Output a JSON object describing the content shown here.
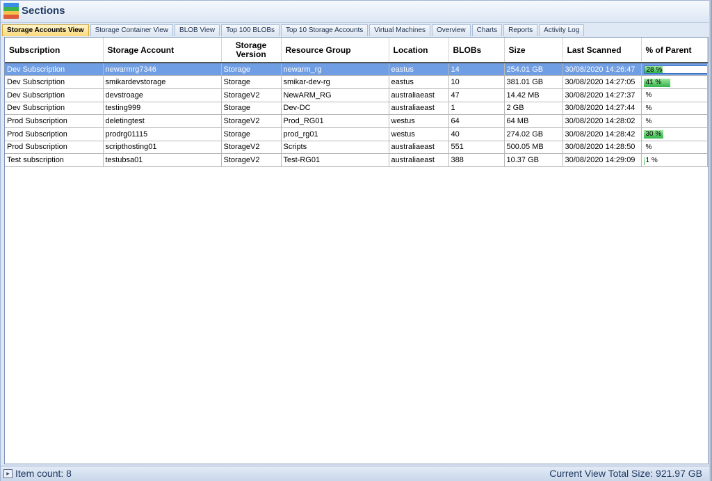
{
  "app": {
    "title": "Sections",
    "icon": "sections-stack-icon",
    "icon_colors": [
      "#3a8ee6",
      "#3cb34b",
      "#f2c14e",
      "#e05a3a"
    ]
  },
  "tabs": [
    {
      "label": "Storage Accounts View",
      "active": true
    },
    {
      "label": "Storage Container View",
      "active": false
    },
    {
      "label": "BLOB View",
      "active": false
    },
    {
      "label": "Top 100 BLOBs",
      "active": false
    },
    {
      "label": "Top 10 Storage Accounts",
      "active": false
    },
    {
      "label": "Virtual Machines",
      "active": false
    },
    {
      "label": "Overview",
      "active": false
    },
    {
      "label": "Charts",
      "active": false
    },
    {
      "label": "Reports",
      "active": false
    },
    {
      "label": "Activity Log",
      "active": false
    }
  ],
  "table": {
    "columns": [
      "Subscription",
      "Storage Account",
      "Storage Version",
      "Resource Group",
      "Location",
      "BLOBs",
      "Size",
      "Last Scanned",
      "% of Parent"
    ],
    "rows": [
      {
        "subscription": "Dev Subscription",
        "account": "newarmrg7346",
        "version": "Storage",
        "group": "newarm_rg",
        "location": "eastus",
        "blobs": "14",
        "size": "254.01 GB",
        "scanned": "30/08/2020 14:26:47",
        "pct_label": "28 %",
        "pct": 28,
        "selected": true
      },
      {
        "subscription": "Dev Subscription",
        "account": "smikardevstorage",
        "version": "Storage",
        "group": "smikar-dev-rg",
        "location": "eastus",
        "blobs": "10",
        "size": "381.01 GB",
        "scanned": "30/08/2020 14:27:05",
        "pct_label": "41 %",
        "pct": 41,
        "selected": false
      },
      {
        "subscription": "Dev Subscription",
        "account": "devstroage",
        "version": "StorageV2",
        "group": "NewARM_RG",
        "location": "australiaeast",
        "blobs": "47",
        "size": "14.42 MB",
        "scanned": "30/08/2020 14:27:37",
        "pct_label": "%",
        "pct": 0,
        "selected": false
      },
      {
        "subscription": "Dev Subscription",
        "account": "testing999",
        "version": "Storage",
        "group": "Dev-DC",
        "location": "australiaeast",
        "blobs": "1",
        "size": "2 GB",
        "scanned": "30/08/2020 14:27:44",
        "pct_label": "%",
        "pct": 0,
        "selected": false
      },
      {
        "subscription": "Prod Subscription",
        "account": "deletingtest",
        "version": "StorageV2",
        "group": "Prod_RG01",
        "location": "westus",
        "blobs": "64",
        "size": "64 MB",
        "scanned": "30/08/2020 14:28:02",
        "pct_label": "%",
        "pct": 0,
        "selected": false
      },
      {
        "subscription": "Prod Subscription",
        "account": "prodrg01115",
        "version": "Storage",
        "group": "prod_rg01",
        "location": "westus",
        "blobs": "40",
        "size": "274.02 GB",
        "scanned": "30/08/2020 14:28:42",
        "pct_label": "30 %",
        "pct": 30,
        "selected": false
      },
      {
        "subscription": "Prod Subscription",
        "account": "scripthosting01",
        "version": "StorageV2",
        "group": "Scripts",
        "location": "australiaeast",
        "blobs": "551",
        "size": "500.05 MB",
        "scanned": "30/08/2020 14:28:50",
        "pct_label": "%",
        "pct": 0,
        "selected": false
      },
      {
        "subscription": "Test subscription",
        "account": "testubsa01",
        "version": "StorageV2",
        "group": "Test-RG01",
        "location": "australiaeast",
        "blobs": "388",
        "size": "10.37 GB",
        "scanned": "30/08/2020 14:29:09",
        "pct_label": "1 %",
        "pct": 1,
        "selected": false
      }
    ]
  },
  "status": {
    "icon": "status-toggle-icon",
    "item_count": "Item count: 8",
    "total_size": "Current View Total Size: 921.97 GB"
  },
  "colors": {
    "selected_row": "#6f9ee4",
    "active_tab": "#fcd97a",
    "progress_fill": "#32b54a"
  }
}
